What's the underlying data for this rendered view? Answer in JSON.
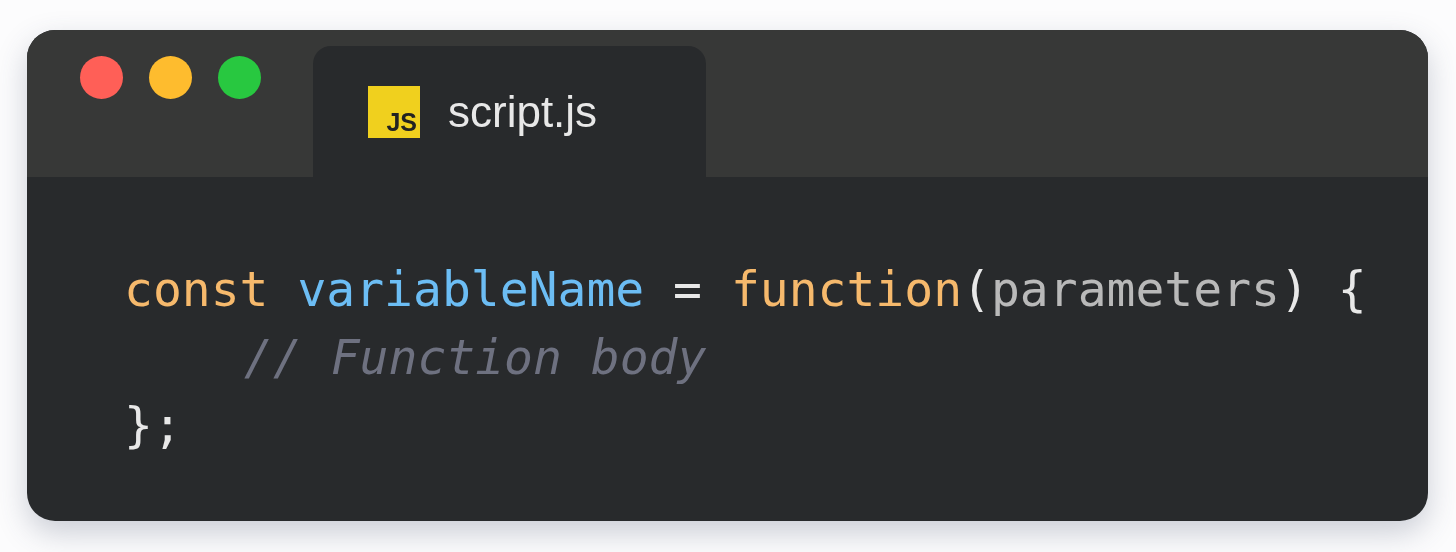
{
  "window": {
    "controls": [
      {
        "color": "#ff5f57"
      },
      {
        "color": "#febc2e"
      },
      {
        "color": "#28c840"
      }
    ],
    "tabs": [
      {
        "label": "script.js",
        "icon_text": "JS",
        "selected": true
      }
    ]
  },
  "code": {
    "lines": [
      {
        "kind": "plain",
        "tokens": [
          {
            "kind": "keyword",
            "text": "const "
          },
          {
            "kind": "variable",
            "text": "variableName "
          },
          {
            "kind": "operator",
            "text": "= "
          },
          {
            "kind": "keyword",
            "text": "function"
          },
          {
            "kind": "punctuation",
            "text": "("
          },
          {
            "kind": "parameter",
            "text": "parameters"
          },
          {
            "kind": "punctuation",
            "text": ") "
          },
          {
            "kind": "punctuation",
            "text": "{"
          }
        ]
      },
      {
        "kind": "indented",
        "tokens": [
          {
            "kind": "comment",
            "text": "// Function body"
          }
        ]
      },
      {
        "kind": "plain",
        "tokens": [
          {
            "kind": "punctuation",
            "text": "};"
          }
        ]
      }
    ]
  }
}
